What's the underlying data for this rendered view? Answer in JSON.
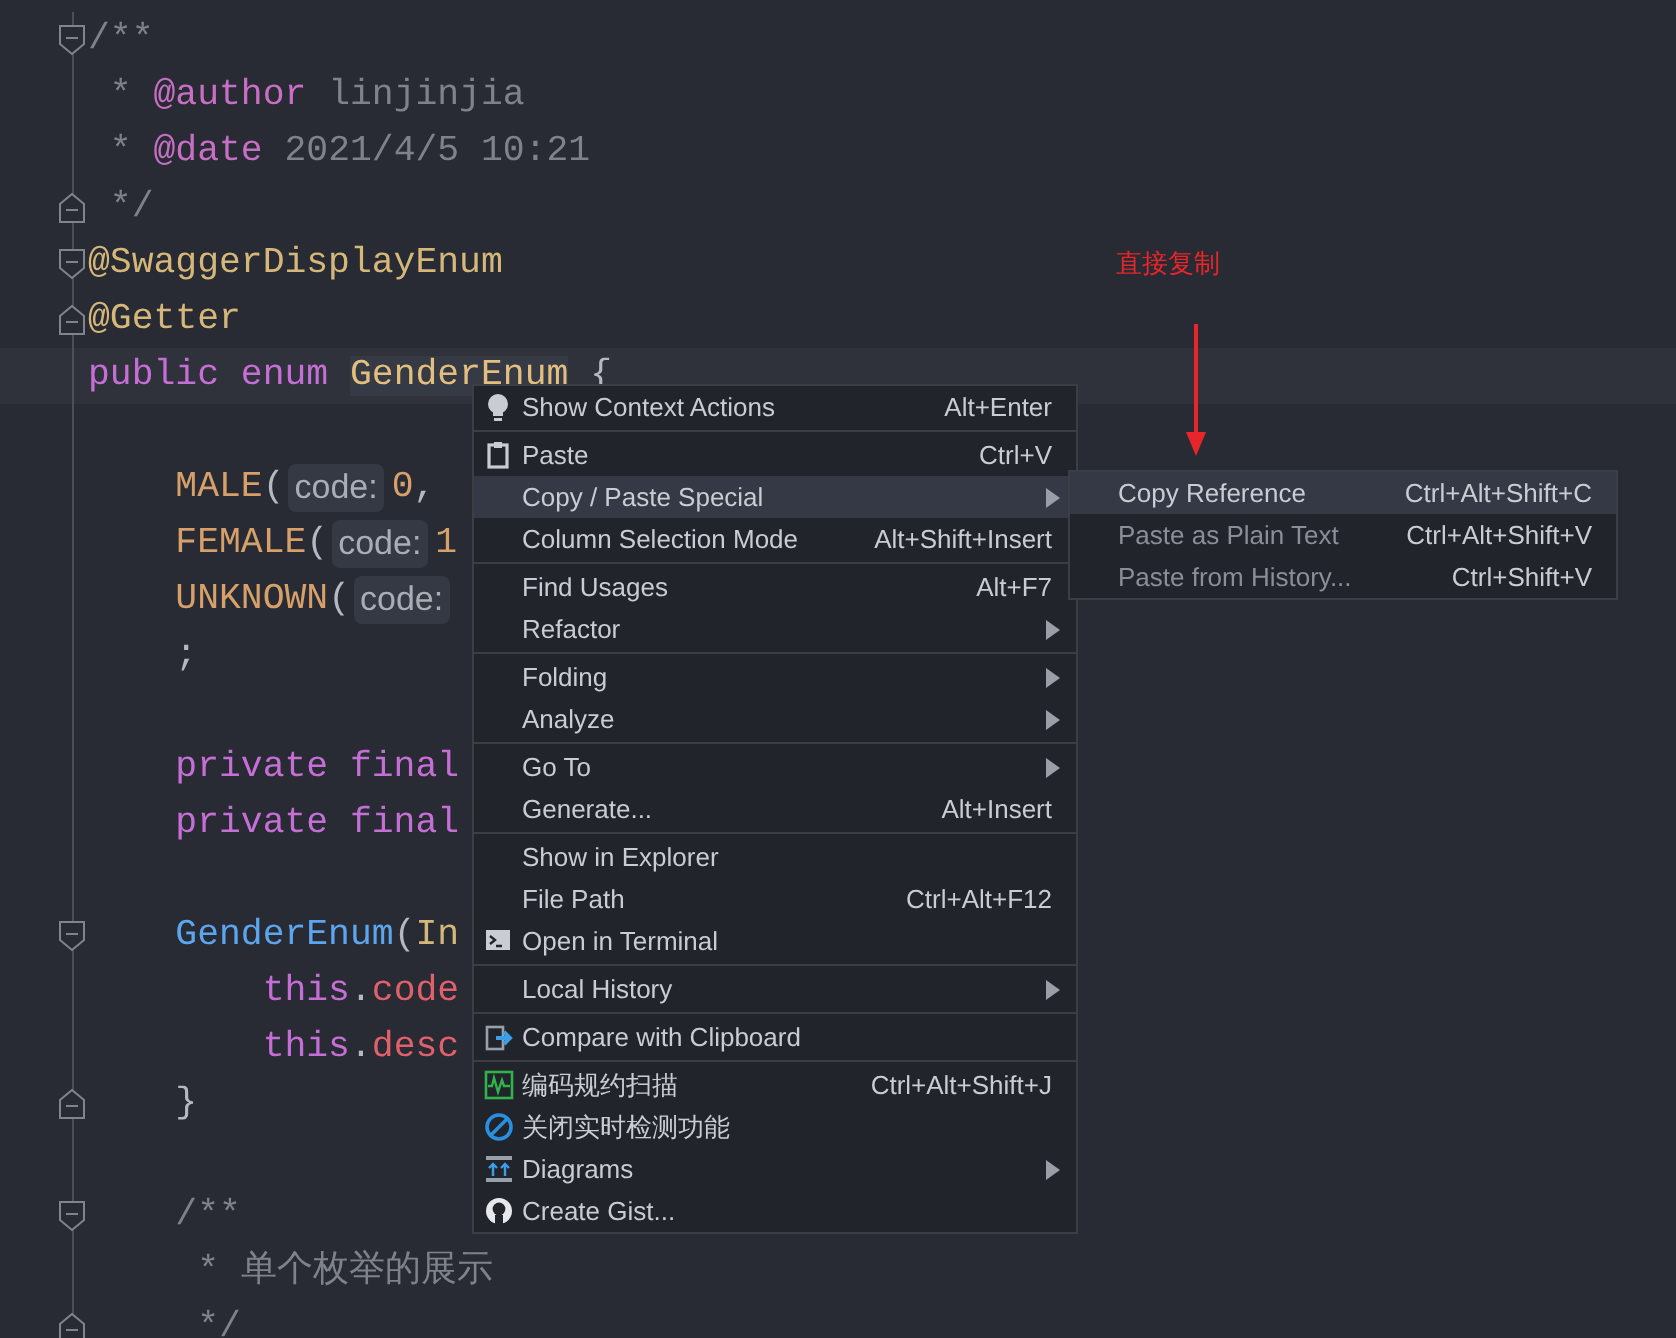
{
  "editor": {
    "lines": [
      {
        "kind": "code",
        "fold_start": true,
        "tokens": [
          {
            "text": "/**",
            "kind": "comment"
          }
        ]
      },
      {
        "kind": "code",
        "tokens": [
          {
            "text": " * ",
            "kind": "comment"
          },
          {
            "text": "@author",
            "kind": "doctag"
          },
          {
            "text": " linjinjia",
            "kind": "comment"
          }
        ]
      },
      {
        "kind": "code",
        "tokens": [
          {
            "text": " * ",
            "kind": "comment"
          },
          {
            "text": "@date",
            "kind": "doctag"
          },
          {
            "text": " 2021/4/5 10:21",
            "kind": "comment"
          }
        ]
      },
      {
        "kind": "code",
        "fold_end": true,
        "tokens": [
          {
            "text": " */",
            "kind": "comment"
          }
        ]
      },
      {
        "kind": "code",
        "fold_start": true,
        "tokens": [
          {
            "text": "@SwaggerDisplayEnum",
            "kind": "annotation"
          }
        ]
      },
      {
        "kind": "code",
        "fold_end": true,
        "tokens": [
          {
            "text": "@Getter",
            "kind": "annotation"
          }
        ]
      },
      {
        "kind": "code",
        "current": true,
        "tokens": [
          {
            "text": "public",
            "kind": "keyword"
          },
          {
            "text": " enum ",
            "kind": "keyword"
          },
          {
            "text": "GenderEnum",
            "kind": "usage"
          },
          {
            "text": " {",
            "kind": "plain"
          }
        ]
      },
      {
        "kind": "blank"
      },
      {
        "kind": "code",
        "tokens": [
          {
            "text": "    MALE",
            "kind": "constant"
          },
          {
            "text": "(",
            "kind": "plain"
          },
          {
            "text": "code:",
            "kind": "hint"
          },
          {
            "text": "0",
            "kind": "number"
          },
          {
            "text": ",",
            "kind": "plain"
          }
        ]
      },
      {
        "kind": "code",
        "tokens": [
          {
            "text": "    FEMALE",
            "kind": "constant"
          },
          {
            "text": "(",
            "kind": "plain"
          },
          {
            "text": "code:",
            "kind": "hint"
          },
          {
            "text": "1",
            "kind": "number"
          }
        ]
      },
      {
        "kind": "code",
        "tokens": [
          {
            "text": "    UNKNOWN",
            "kind": "constant"
          },
          {
            "text": "(",
            "kind": "plain"
          },
          {
            "text": "code:",
            "kind": "hint"
          }
        ]
      },
      {
        "kind": "code",
        "tokens": [
          {
            "text": "    ;",
            "kind": "plain"
          }
        ]
      },
      {
        "kind": "blank"
      },
      {
        "kind": "code",
        "tokens": [
          {
            "text": "    private final",
            "kind": "keyword"
          }
        ]
      },
      {
        "kind": "code",
        "tokens": [
          {
            "text": "    private final",
            "kind": "keyword"
          }
        ]
      },
      {
        "kind": "blank"
      },
      {
        "kind": "code",
        "fold_start": true,
        "tokens": [
          {
            "text": "    GenderEnum",
            "kind": "function"
          },
          {
            "text": "(",
            "kind": "plain"
          },
          {
            "text": "In",
            "kind": "type"
          }
        ]
      },
      {
        "kind": "code",
        "tokens": [
          {
            "text": "        this",
            "kind": "keyword"
          },
          {
            "text": ".",
            "kind": "plain"
          },
          {
            "text": "code",
            "kind": "field"
          }
        ]
      },
      {
        "kind": "code",
        "tokens": [
          {
            "text": "        this",
            "kind": "keyword"
          },
          {
            "text": ".",
            "kind": "plain"
          },
          {
            "text": "desc",
            "kind": "field"
          }
        ]
      },
      {
        "kind": "code",
        "fold_end": true,
        "tokens": [
          {
            "text": "    }",
            "kind": "plain"
          }
        ]
      },
      {
        "kind": "blank"
      },
      {
        "kind": "code",
        "fold_start": true,
        "tokens": [
          {
            "text": "    /**",
            "kind": "comment"
          }
        ]
      },
      {
        "kind": "code",
        "tokens": [
          {
            "text": "     * 单个枚举的展示",
            "kind": "comment"
          }
        ]
      },
      {
        "kind": "code",
        "fold_end": true,
        "tokens": [
          {
            "text": "     */",
            "kind": "comment"
          }
        ]
      }
    ]
  },
  "annotation": {
    "text": "直接复制"
  },
  "context_menu": {
    "items": [
      {
        "kind": "item",
        "label": "Show Context Actions",
        "shortcut": "Alt+Enter",
        "submenu": false,
        "selected": false
      },
      {
        "kind": "separator"
      },
      {
        "kind": "item",
        "label": "Paste",
        "shortcut": "Ctrl+V",
        "submenu": false,
        "selected": false
      },
      {
        "kind": "item",
        "label": "Copy / Paste Special",
        "submenu": true,
        "selected": true
      },
      {
        "kind": "item",
        "label": "Column Selection Mode",
        "shortcut": "Alt+Shift+Insert",
        "submenu": false,
        "selected": false
      },
      {
        "kind": "separator"
      },
      {
        "kind": "item",
        "label": "Find Usages",
        "shortcut": "Alt+F7",
        "submenu": false,
        "selected": false
      },
      {
        "kind": "item",
        "label": "Refactor",
        "submenu": true,
        "selected": false
      },
      {
        "kind": "separator"
      },
      {
        "kind": "item",
        "label": "Folding",
        "submenu": true,
        "selected": false
      },
      {
        "kind": "item",
        "label": "Analyze",
        "submenu": true,
        "selected": false
      },
      {
        "kind": "separator"
      },
      {
        "kind": "item",
        "label": "Go To",
        "submenu": true,
        "selected": false
      },
      {
        "kind": "item",
        "label": "Generate...",
        "shortcut": "Alt+Insert",
        "submenu": false,
        "selected": false
      },
      {
        "kind": "separator"
      },
      {
        "kind": "item",
        "label": "Show in Explorer",
        "submenu": false,
        "selected": false
      },
      {
        "kind": "item",
        "label": "File Path",
        "shortcut": "Ctrl+Alt+F12",
        "submenu": false,
        "selected": false
      },
      {
        "kind": "item",
        "label": "Open in Terminal",
        "submenu": false,
        "selected": false
      },
      {
        "kind": "separator"
      },
      {
        "kind": "item",
        "label": "Local History",
        "submenu": true,
        "selected": false
      },
      {
        "kind": "separator"
      },
      {
        "kind": "item",
        "label": "Compare with Clipboard",
        "submenu": false,
        "selected": false
      },
      {
        "kind": "separator"
      },
      {
        "kind": "item",
        "label": "编码规约扫描",
        "shortcut": "Ctrl+Alt+Shift+J",
        "submenu": false,
        "selected": false
      },
      {
        "kind": "item",
        "label": "关闭实时检测功能",
        "submenu": false,
        "selected": false
      },
      {
        "kind": "item",
        "label": "Diagrams",
        "submenu": true,
        "selected": false
      },
      {
        "kind": "item",
        "label": "Create Gist...",
        "submenu": false,
        "selected": false
      }
    ]
  },
  "submenu": {
    "items": [
      {
        "label": "Copy Reference",
        "shortcut": "Ctrl+Alt+Shift+C",
        "selected": true,
        "disabled": false
      },
      {
        "label": "Paste as Plain Text",
        "shortcut": "Ctrl+Alt+Shift+V",
        "selected": false,
        "disabled": true
      },
      {
        "label": "Paste from History...",
        "shortcut": "Ctrl+Shift+V",
        "selected": false,
        "disabled": true
      }
    ]
  }
}
